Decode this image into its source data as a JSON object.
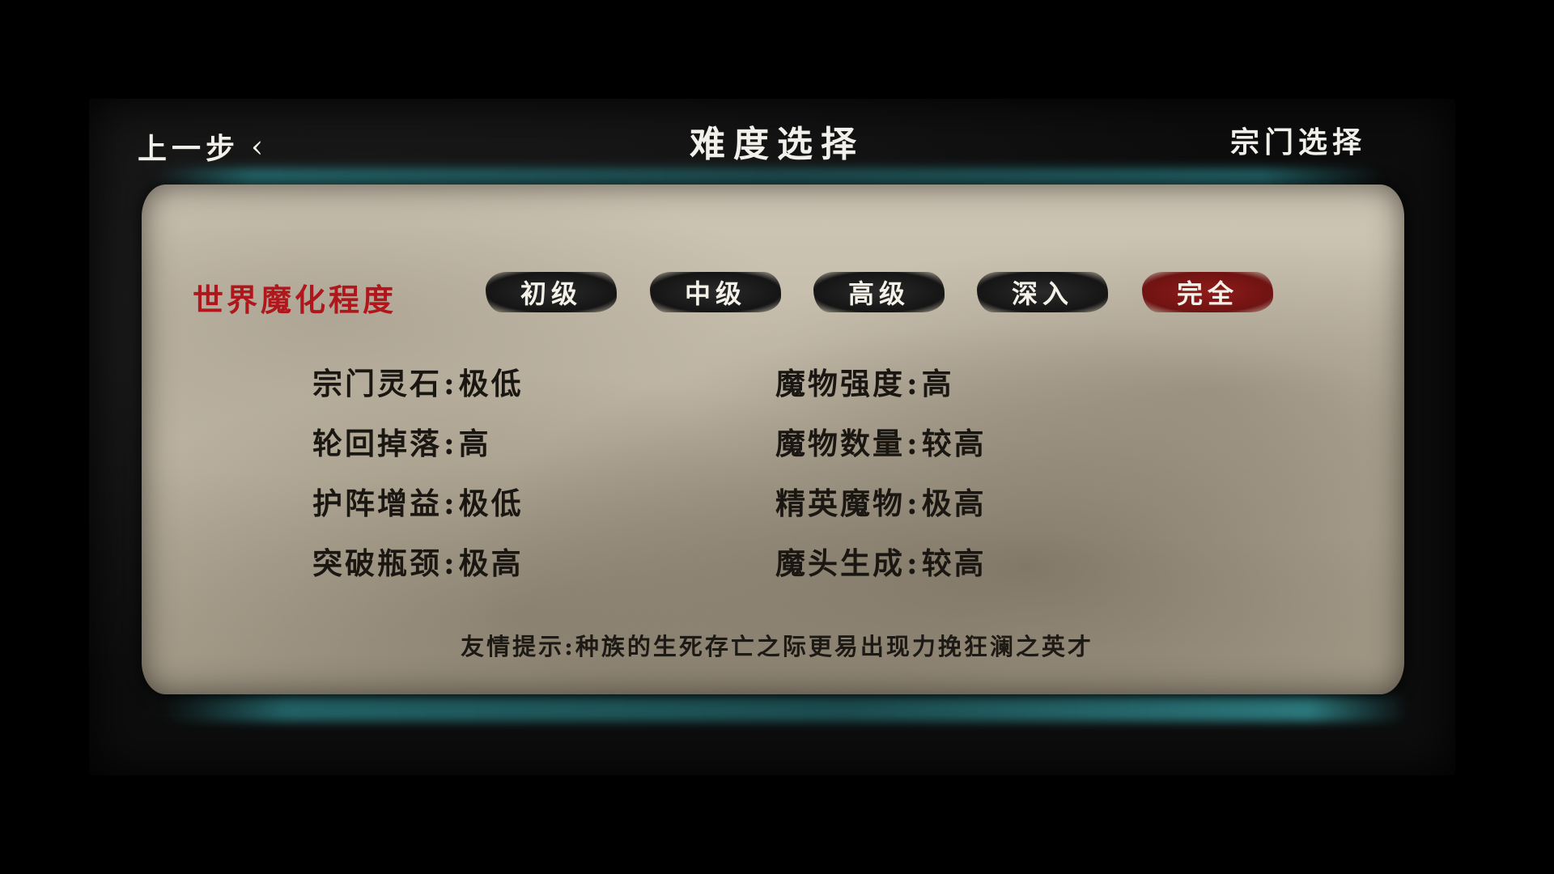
{
  "nav": {
    "back_label": "上一步",
    "back_chevron": "‹",
    "title": "难度选择",
    "next_label": "宗门选择"
  },
  "difficulty": {
    "row_label": "世界魔化程度",
    "levels": [
      "初级",
      "中级",
      "高级",
      "深入",
      "完全"
    ],
    "selected": "完全",
    "selected_color": "#8f1c1b",
    "label_color": "#b0171c"
  },
  "stats": {
    "left": [
      {
        "name": "宗门灵石",
        "value": "极低"
      },
      {
        "name": "轮回掉落",
        "value": "高"
      },
      {
        "name": "护阵增益",
        "value": "极低"
      },
      {
        "name": "突破瓶颈",
        "value": "极高"
      }
    ],
    "right": [
      {
        "name": "魔物强度",
        "value": "高"
      },
      {
        "name": "魔物数量",
        "value": "较高"
      },
      {
        "name": "精英魔物",
        "value": "极高"
      },
      {
        "name": "魔头生成",
        "value": "较高"
      }
    ],
    "separator": ":"
  },
  "tip": "友情提示:种族的生死存亡之际更易出现力挽狂澜之英才"
}
